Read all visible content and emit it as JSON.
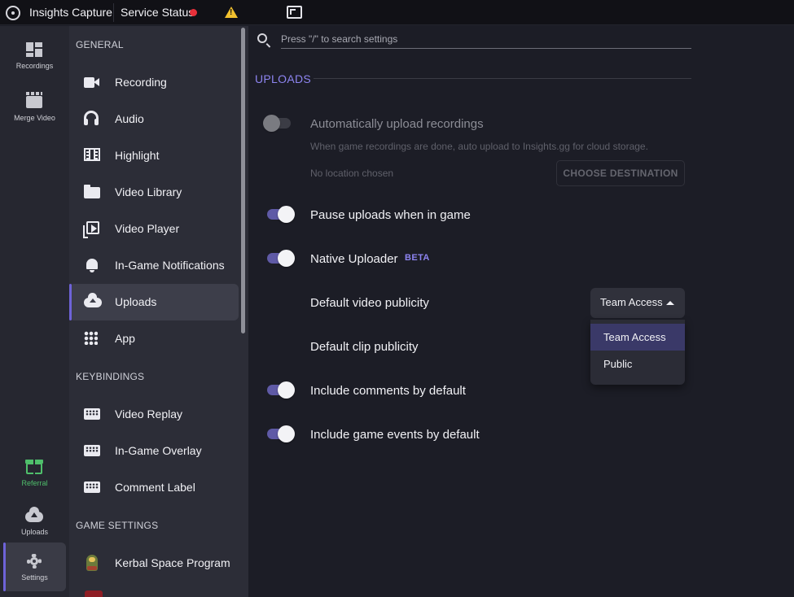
{
  "titlebar": {
    "app_name": "Insights Capture",
    "service_status": "Service Status",
    "status_color": "#e8303a",
    "warning_color": "#f2c12e"
  },
  "rail": {
    "items": [
      {
        "label": "Recordings",
        "icon": "dashboard-icon"
      },
      {
        "label": "Merge Video",
        "icon": "clapperboard-icon"
      },
      {
        "label": "Referral",
        "icon": "gift-icon",
        "color": "#4fbf6b"
      },
      {
        "label": "Uploads",
        "icon": "cloud-upload-icon"
      },
      {
        "label": "Settings",
        "icon": "gear-icon",
        "active": true
      }
    ]
  },
  "nav": {
    "general_heading": "GENERAL",
    "general_items": [
      {
        "label": "Recording",
        "icon": "video-camera-icon"
      },
      {
        "label": "Audio",
        "icon": "headset-icon"
      },
      {
        "label": "Highlight",
        "icon": "film-icon"
      },
      {
        "label": "Video Library",
        "icon": "folder-icon"
      },
      {
        "label": "Video Player",
        "icon": "play-library-icon"
      },
      {
        "label": "In-Game Notifications",
        "icon": "bell-icon"
      },
      {
        "label": "Uploads",
        "icon": "cloud-upload-icon",
        "active": true
      },
      {
        "label": "App",
        "icon": "apps-grid-icon"
      }
    ],
    "keybindings_heading": "KEYBINDINGS",
    "keybinding_items": [
      {
        "label": "Video Replay",
        "icon": "keyboard-icon"
      },
      {
        "label": "In-Game Overlay",
        "icon": "keyboard-icon"
      },
      {
        "label": "Comment Label",
        "icon": "keyboard-icon"
      }
    ],
    "game_settings_heading": "GAME SETTINGS",
    "game_items": [
      {
        "label": "Kerbal Space Program",
        "icon": "kerbal-game-icon"
      }
    ]
  },
  "main": {
    "search": {
      "placeholder": "Press \"/\" to search settings"
    },
    "section_title": "UPLOADS",
    "auto_upload": {
      "label": "Automatically upload recordings",
      "description": "When game recordings are done, auto upload to Insights.gg for cloud storage.",
      "location": "No location chosen",
      "button": "CHOOSE DESTINATION",
      "enabled": false
    },
    "pause_uploads": {
      "label": "Pause uploads when in game",
      "enabled": true
    },
    "native_uploader": {
      "label": "Native Uploader",
      "badge": "BETA",
      "enabled": true
    },
    "video_publicity": {
      "label": "Default video publicity",
      "selected": "Team Access"
    },
    "clip_publicity": {
      "label": "Default clip publicity"
    },
    "publicity_options": [
      "Team Access",
      "Public"
    ],
    "include_comments": {
      "label": "Include comments by default",
      "enabled": true
    },
    "include_events": {
      "label": "Include game events by default",
      "enabled": true
    },
    "accent_color": "#8d84f0",
    "toggle_on_color": "#5f5aa6"
  }
}
